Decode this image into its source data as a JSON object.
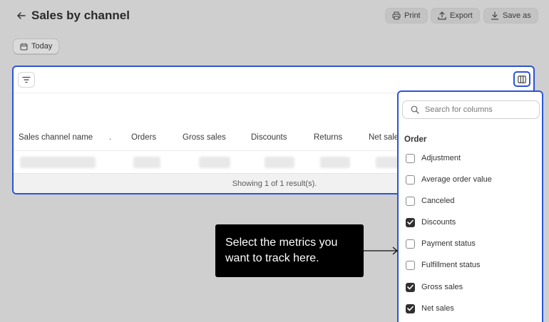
{
  "header": {
    "title": "Sales by channel",
    "print_label": "Print",
    "export_label": "Export",
    "save_as_label": "Save as"
  },
  "filters": {
    "date_label": "Today"
  },
  "table": {
    "columns": [
      "Sales channel name",
      ".",
      "Orders",
      "Gross sales",
      "Discounts",
      "Returns",
      "Net sale"
    ],
    "footer": "Showing 1 of 1 result(s)."
  },
  "column_picker": {
    "search_placeholder": "Search for columns",
    "section_title": "Order",
    "options": [
      {
        "label": "Adjustment",
        "checked": false
      },
      {
        "label": "Average order value",
        "checked": false
      },
      {
        "label": "Canceled",
        "checked": false
      },
      {
        "label": "Discounts",
        "checked": true
      },
      {
        "label": "Payment status",
        "checked": false
      },
      {
        "label": "Fulfillment status",
        "checked": false
      },
      {
        "label": "Gross sales",
        "checked": true
      },
      {
        "label": "Net sales",
        "checked": true
      }
    ]
  },
  "tooltip": {
    "text": "Select the metrics you want to track here."
  },
  "colors": {
    "accent": "#2c54d6",
    "overlay": "#cfcfcf",
    "tooltip_bg": "#000000"
  }
}
